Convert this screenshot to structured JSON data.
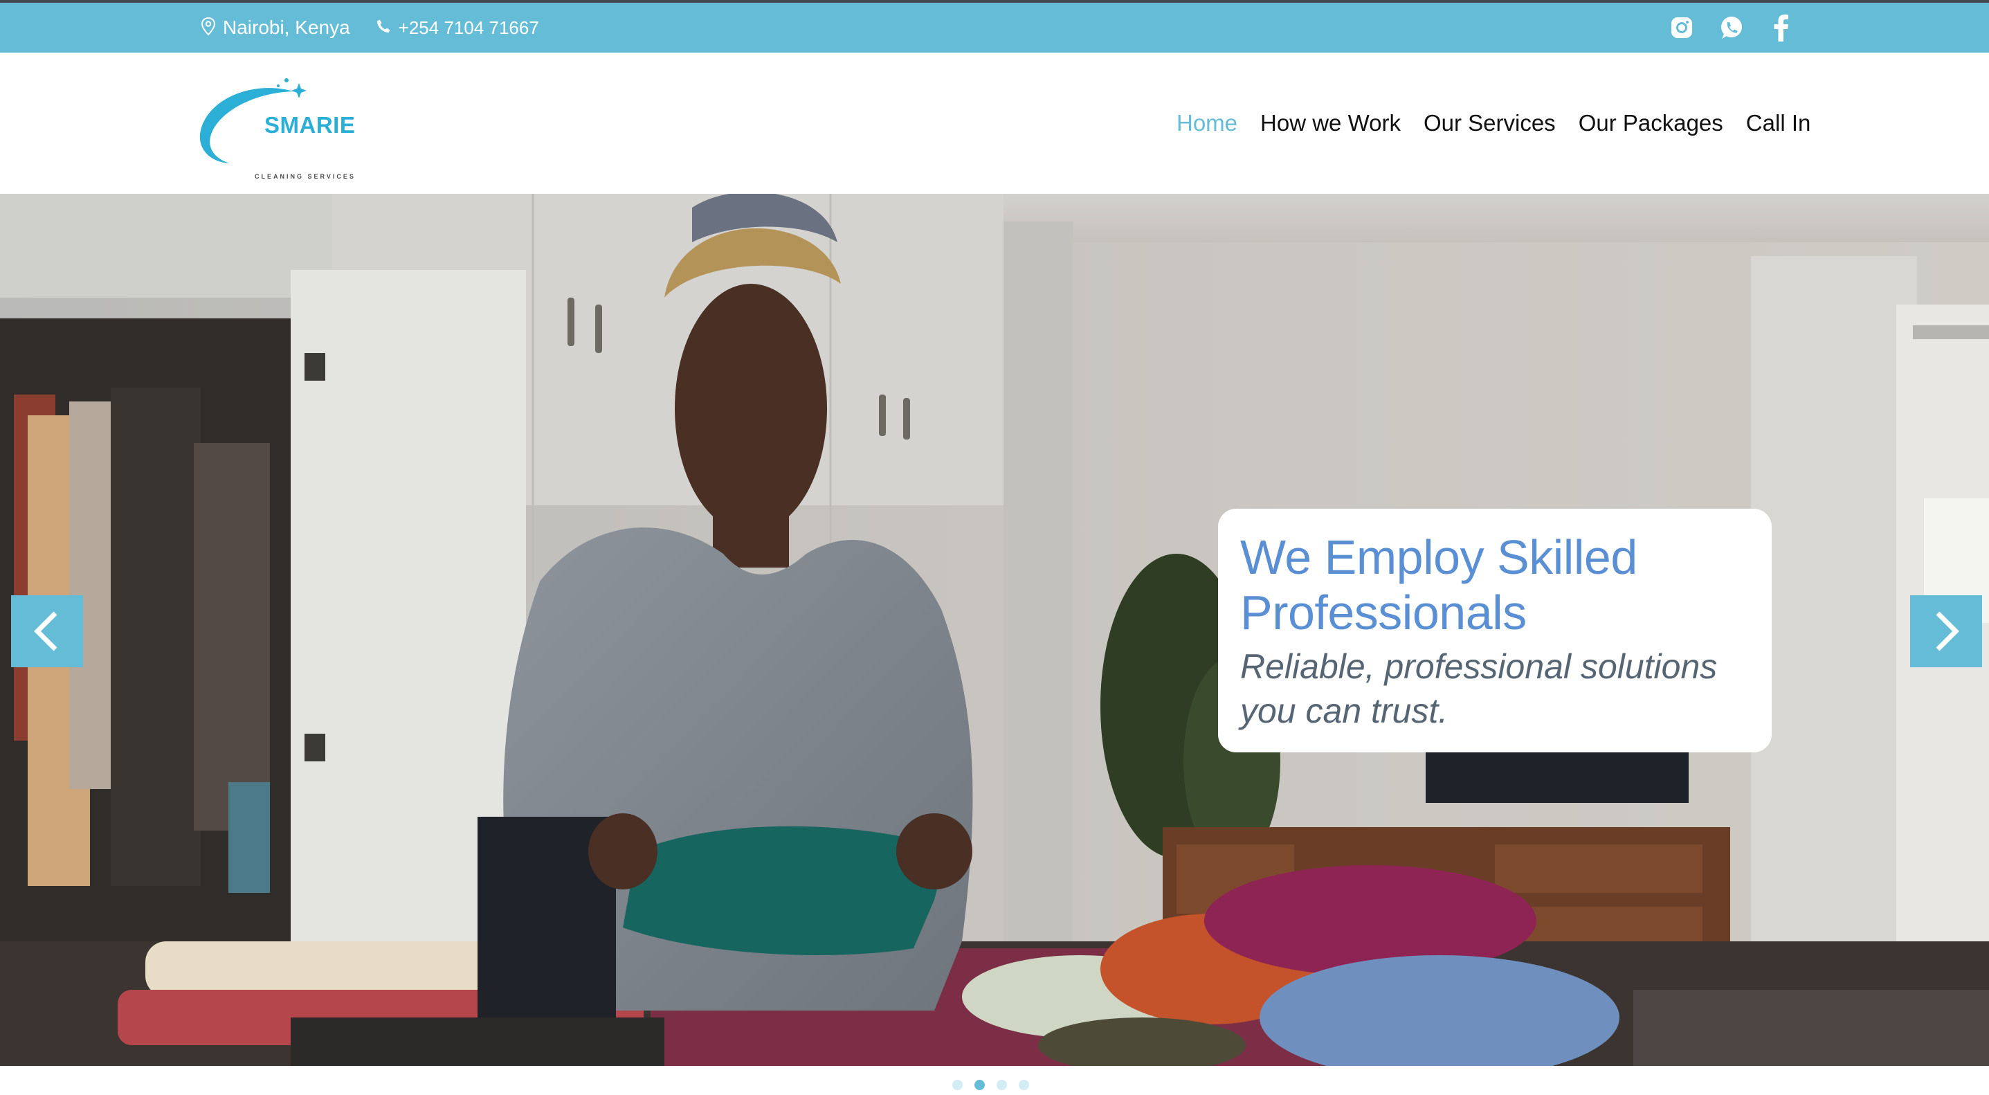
{
  "topbar": {
    "location": "Nairobi, Kenya",
    "phone": "+254 7104 71667",
    "social": [
      {
        "name": "instagram-icon"
      },
      {
        "name": "whatsapp-icon"
      },
      {
        "name": "facebook-icon"
      }
    ]
  },
  "logo": {
    "brand": "SMARIE",
    "tagline": "CLEANING SERVICES"
  },
  "nav": {
    "items": [
      {
        "label": "Home",
        "active": true
      },
      {
        "label": "How we Work",
        "active": false
      },
      {
        "label": "Our Services",
        "active": false
      },
      {
        "label": "Our Packages",
        "active": false
      },
      {
        "label": "Call In",
        "active": false
      }
    ]
  },
  "hero": {
    "title": "We Employ Skilled Professionals",
    "subtitle": "Reliable, professional solutions you can trust.",
    "controls": {
      "prev": "chevron-left-icon",
      "next": "chevron-right-icon"
    },
    "slides_total": 4,
    "slide_active": 2
  },
  "colors": {
    "accent": "#64bcd7",
    "title_blue": "#5b8fd4",
    "subtitle_gray": "#566573",
    "topbar_border": "#444a50"
  }
}
